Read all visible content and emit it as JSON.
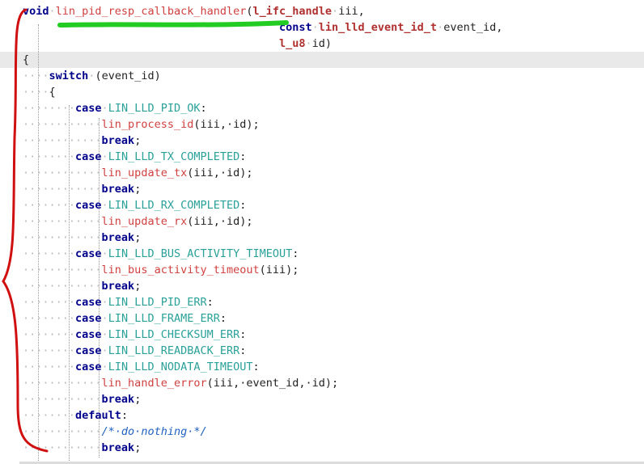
{
  "editor": {
    "colors": {
      "keyword": "#00008b",
      "type": "#b03030",
      "function": "#d04040",
      "constant": "#2aa198",
      "comment": "#2060c0",
      "current_line": "#e9e9e9",
      "brace_annotation": "#d01010",
      "underline_annotation": "#22cc22"
    },
    "lines": [
      [
        [
          "kw",
          "void"
        ],
        [
          "ws",
          "·"
        ],
        [
          "fn",
          "lin_pid_resp_callback_handler"
        ],
        [
          "plain",
          "("
        ],
        [
          "type",
          "l_ifc_handle"
        ],
        [
          "ws",
          "·"
        ],
        [
          "plain",
          "iii,"
        ]
      ],
      [
        [
          "ws",
          "                                       "
        ],
        [
          "kw",
          "const"
        ],
        [
          "ws",
          "·"
        ],
        [
          "type",
          "lin_lld_event_id_t"
        ],
        [
          "ws",
          "·"
        ],
        [
          "plain",
          "event_id,"
        ]
      ],
      [
        [
          "ws",
          "                                       "
        ],
        [
          "type",
          "l_u8"
        ],
        [
          "ws",
          "·"
        ],
        [
          "plain",
          "id)"
        ]
      ],
      [
        [
          "plain",
          "{"
        ]
      ],
      [
        [
          "ws",
          "····"
        ],
        [
          "kw",
          "switch"
        ],
        [
          "ws",
          "·"
        ],
        [
          "plain",
          "(event_id)"
        ]
      ],
      [
        [
          "ws",
          "····"
        ],
        [
          "plain",
          "{"
        ]
      ],
      [
        [
          "ws",
          "········"
        ],
        [
          "kw",
          "case"
        ],
        [
          "ws",
          "·"
        ],
        [
          "const",
          "LIN_LLD_PID_OK"
        ],
        [
          "plain",
          ":"
        ]
      ],
      [
        [
          "ws",
          "············"
        ],
        [
          "fn",
          "lin_process_id"
        ],
        [
          "plain",
          "(iii,·id);"
        ]
      ],
      [
        [
          "ws",
          "············"
        ],
        [
          "kw",
          "break"
        ],
        [
          "plain",
          ";"
        ]
      ],
      [
        [
          "ws",
          "········"
        ],
        [
          "kw",
          "case"
        ],
        [
          "ws",
          "·"
        ],
        [
          "const",
          "LIN_LLD_TX_COMPLETED"
        ],
        [
          "plain",
          ":"
        ]
      ],
      [
        [
          "ws",
          "············"
        ],
        [
          "fn",
          "lin_update_tx"
        ],
        [
          "plain",
          "(iii,·id);"
        ]
      ],
      [
        [
          "ws",
          "············"
        ],
        [
          "kw",
          "break"
        ],
        [
          "plain",
          ";"
        ]
      ],
      [
        [
          "ws",
          "········"
        ],
        [
          "kw",
          "case"
        ],
        [
          "ws",
          "·"
        ],
        [
          "const",
          "LIN_LLD_RX_COMPLETED"
        ],
        [
          "plain",
          ":"
        ]
      ],
      [
        [
          "ws",
          "············"
        ],
        [
          "fn",
          "lin_update_rx"
        ],
        [
          "plain",
          "(iii,·id);"
        ]
      ],
      [
        [
          "ws",
          "············"
        ],
        [
          "kw",
          "break"
        ],
        [
          "plain",
          ";"
        ]
      ],
      [
        [
          "ws",
          "········"
        ],
        [
          "kw",
          "case"
        ],
        [
          "ws",
          "·"
        ],
        [
          "const",
          "LIN_LLD_BUS_ACTIVITY_TIMEOUT"
        ],
        [
          "plain",
          ":"
        ]
      ],
      [
        [
          "ws",
          "············"
        ],
        [
          "fn",
          "lin_bus_activity_timeout"
        ],
        [
          "plain",
          "(iii);"
        ]
      ],
      [
        [
          "ws",
          "············"
        ],
        [
          "kw",
          "break"
        ],
        [
          "plain",
          ";"
        ]
      ],
      [
        [
          "ws",
          "········"
        ],
        [
          "kw",
          "case"
        ],
        [
          "ws",
          "·"
        ],
        [
          "const",
          "LIN_LLD_PID_ERR"
        ],
        [
          "plain",
          ":"
        ]
      ],
      [
        [
          "ws",
          "········"
        ],
        [
          "kw",
          "case"
        ],
        [
          "ws",
          "·"
        ],
        [
          "const",
          "LIN_LLD_FRAME_ERR"
        ],
        [
          "plain",
          ":"
        ]
      ],
      [
        [
          "ws",
          "········"
        ],
        [
          "kw",
          "case"
        ],
        [
          "ws",
          "·"
        ],
        [
          "const",
          "LIN_LLD_CHECKSUM_ERR"
        ],
        [
          "plain",
          ":"
        ]
      ],
      [
        [
          "ws",
          "········"
        ],
        [
          "kw",
          "case"
        ],
        [
          "ws",
          "·"
        ],
        [
          "const",
          "LIN_LLD_READBACK_ERR"
        ],
        [
          "plain",
          ":"
        ]
      ],
      [
        [
          "ws",
          "········"
        ],
        [
          "kw",
          "case"
        ],
        [
          "ws",
          "·"
        ],
        [
          "const",
          "LIN_LLD_NODATA_TIMEOUT"
        ],
        [
          "plain",
          ":"
        ]
      ],
      [
        [
          "ws",
          "············"
        ],
        [
          "fn",
          "lin_handle_error"
        ],
        [
          "plain",
          "(iii,·event_id,·id);"
        ]
      ],
      [
        [
          "ws",
          "············"
        ],
        [
          "kw",
          "break"
        ],
        [
          "plain",
          ";"
        ]
      ],
      [
        [
          "ws",
          "········"
        ],
        [
          "kw",
          "default"
        ],
        [
          "plain",
          ":"
        ]
      ],
      [
        [
          "ws",
          "············"
        ],
        [
          "comment",
          "/*·do·nothing·*/"
        ]
      ],
      [
        [
          "ws",
          "············"
        ],
        [
          "kw",
          "break"
        ],
        [
          "plain",
          ";"
        ]
      ]
    ]
  }
}
